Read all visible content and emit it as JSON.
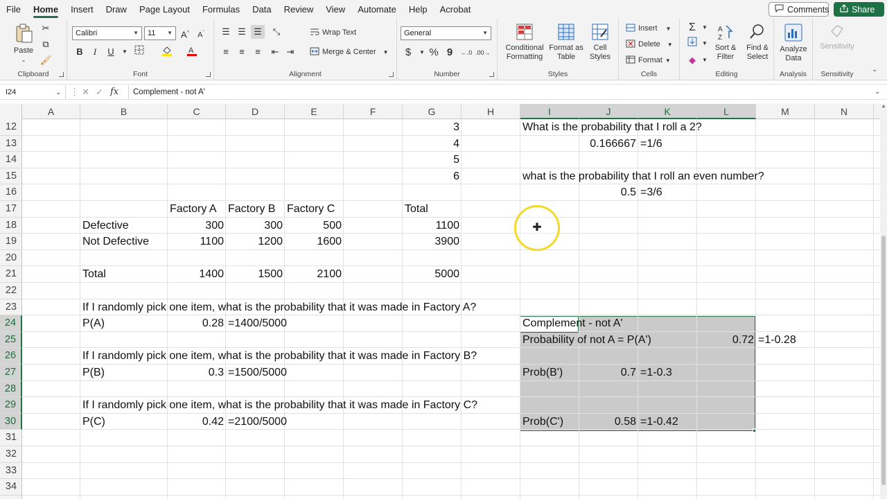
{
  "menu": {
    "tabs": [
      "File",
      "Home",
      "Insert",
      "Draw",
      "Page Layout",
      "Formulas",
      "Data",
      "Review",
      "View",
      "Automate",
      "Help",
      "Acrobat"
    ],
    "active_tab": "Home",
    "comments_label": "Comments",
    "share_label": "Share"
  },
  "ribbon": {
    "clipboard": {
      "label": "Clipboard",
      "paste": "Paste"
    },
    "font": {
      "label": "Font",
      "font_name": "Calibri",
      "font_size": "11",
      "bold": "B",
      "italic": "I",
      "underline": "U"
    },
    "alignment": {
      "label": "Alignment",
      "wrap_text": "Wrap Text",
      "merge_center": "Merge & Center"
    },
    "number": {
      "label": "Number",
      "format": "General",
      "currency": "$",
      "percent": "%",
      "comma": "9"
    },
    "styles": {
      "label": "Styles",
      "conditional_formatting": "Conditional Formatting",
      "format_as_table": "Format as Table",
      "cell_styles": "Cell Styles"
    },
    "cells": {
      "label": "Cells",
      "insert": "Insert",
      "delete": "Delete",
      "format": "Format"
    },
    "editing": {
      "label": "Editing",
      "sort_filter": "Sort & Filter",
      "find_select": "Find & Select"
    },
    "analysis": {
      "label": "Analysis",
      "analyze_data": "Analyze Data"
    },
    "sensitivity": {
      "label": "Sensitivity",
      "button": "Sensitivity"
    }
  },
  "formula_bar": {
    "name_box": "I24",
    "fx": "fx",
    "content": "Complement - not A'"
  },
  "sheet": {
    "columns": [
      "A",
      "B",
      "C",
      "D",
      "E",
      "F",
      "G",
      "H",
      "I",
      "J",
      "K",
      "L",
      "M",
      "N"
    ],
    "rows": [
      "12",
      "13",
      "14",
      "15",
      "16",
      "17",
      "18",
      "19",
      "20",
      "21",
      "22",
      "23",
      "24",
      "25",
      "26",
      "27",
      "28",
      "29",
      "30",
      "31",
      "32",
      "33",
      "34"
    ],
    "cells": [
      {
        "ref": "G12",
        "value": "3"
      },
      {
        "ref": "I12",
        "value": "What is the probability that I roll a 2?"
      },
      {
        "ref": "G13",
        "value": "4"
      },
      {
        "ref": "J13",
        "value": "0.166667"
      },
      {
        "ref": "K13",
        "value": "=1/6"
      },
      {
        "ref": "G14",
        "value": "5"
      },
      {
        "ref": "G15",
        "value": "6"
      },
      {
        "ref": "I15",
        "value": "what is the probability that I roll an even number?"
      },
      {
        "ref": "J16",
        "value": "0.5"
      },
      {
        "ref": "K16",
        "value": "=3/6"
      },
      {
        "ref": "C17",
        "value": "Factory A"
      },
      {
        "ref": "D17",
        "value": "Factory B"
      },
      {
        "ref": "E17",
        "value": "Factory C"
      },
      {
        "ref": "G17",
        "value": "Total"
      },
      {
        "ref": "B18",
        "value": "Defective"
      },
      {
        "ref": "C18",
        "value": "300"
      },
      {
        "ref": "D18",
        "value": "300"
      },
      {
        "ref": "E18",
        "value": "500"
      },
      {
        "ref": "G18",
        "value": "1100"
      },
      {
        "ref": "B19",
        "value": "Not Defective"
      },
      {
        "ref": "C19",
        "value": "1100"
      },
      {
        "ref": "D19",
        "value": "1200"
      },
      {
        "ref": "E19",
        "value": "1600"
      },
      {
        "ref": "G19",
        "value": "3900"
      },
      {
        "ref": "B21",
        "value": "Total"
      },
      {
        "ref": "C21",
        "value": "1400"
      },
      {
        "ref": "D21",
        "value": "1500"
      },
      {
        "ref": "E21",
        "value": "2100"
      },
      {
        "ref": "G21",
        "value": "5000"
      },
      {
        "ref": "B23",
        "value": "If I randomly pick one item, what is the probability that it was made in Factory A?"
      },
      {
        "ref": "B24",
        "value": "P(A)"
      },
      {
        "ref": "C24",
        "value": "0.28"
      },
      {
        "ref": "D24",
        "value": "=1400/5000"
      },
      {
        "ref": "I24",
        "value": "Complement - not A'"
      },
      {
        "ref": "I25",
        "value": "Probability of not A = P(A')"
      },
      {
        "ref": "L25",
        "value": "0.72"
      },
      {
        "ref": "M25",
        "value": "=1-0.28"
      },
      {
        "ref": "B26",
        "value": "If I randomly pick one item, what is the probability that it was made in Factory B?"
      },
      {
        "ref": "B27",
        "value": "P(B)"
      },
      {
        "ref": "C27",
        "value": "0.3"
      },
      {
        "ref": "D27",
        "value": "=1500/5000"
      },
      {
        "ref": "I27",
        "value": "Prob(B')"
      },
      {
        "ref": "J27",
        "value": "0.7"
      },
      {
        "ref": "K27",
        "value": "=1-0.3"
      },
      {
        "ref": "B29",
        "value": "If I randomly pick one item, what is the probability that it was made in Factory C?"
      },
      {
        "ref": "B30",
        "value": "P(C)"
      },
      {
        "ref": "C30",
        "value": "0.42"
      },
      {
        "ref": "D30",
        "value": "=2100/5000"
      },
      {
        "ref": "I30",
        "value": "Prob(C')"
      },
      {
        "ref": "J30",
        "value": "0.58"
      },
      {
        "ref": "K30",
        "value": "=1-0.42"
      }
    ],
    "selected_range": "I24:L30",
    "active_cell": "I24"
  },
  "colors": {
    "accent": "#217346",
    "share_bg": "#1e7145",
    "selection_tint": "#808080",
    "cursor_highlight": "#f2d92a"
  }
}
